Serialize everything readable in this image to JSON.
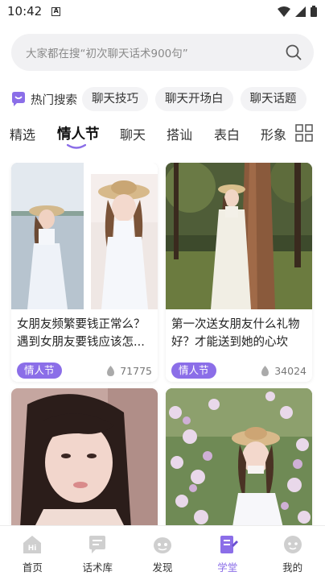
{
  "status_bar": {
    "time": "10:42",
    "notif_icon": "A"
  },
  "search": {
    "placeholder": "大家都在搜“初次聊天话术900句”"
  },
  "hot": {
    "label": "热门搜索",
    "chips": [
      "聊天技巧",
      "聊天开场白",
      "聊天话题"
    ]
  },
  "tabs": [
    "精选",
    "情人节",
    "聊天",
    "搭讪",
    "表白",
    "形象"
  ],
  "active_tab": "情人节",
  "cards": [
    {
      "title": "女朋友频繁要钱正常么？遇到女朋友要钱应该怎...",
      "tag": "情人节",
      "likes": "71775"
    },
    {
      "title": "第一次送女朋友什么礼物好？才能送到她的心坎",
      "tag": "情人节",
      "likes": "34024"
    }
  ],
  "bottom_nav": [
    {
      "label": "首页",
      "icon": "hi-home-icon"
    },
    {
      "label": "话术库",
      "icon": "chat-library-icon"
    },
    {
      "label": "发现",
      "icon": "discover-icon"
    },
    {
      "label": "学堂",
      "icon": "school-icon"
    },
    {
      "label": "我的",
      "icon": "profile-icon"
    }
  ],
  "colors": {
    "accent": "#8b6ee8",
    "chip_bg": "#f3f3f5",
    "search_bg": "#f1f1f3"
  }
}
